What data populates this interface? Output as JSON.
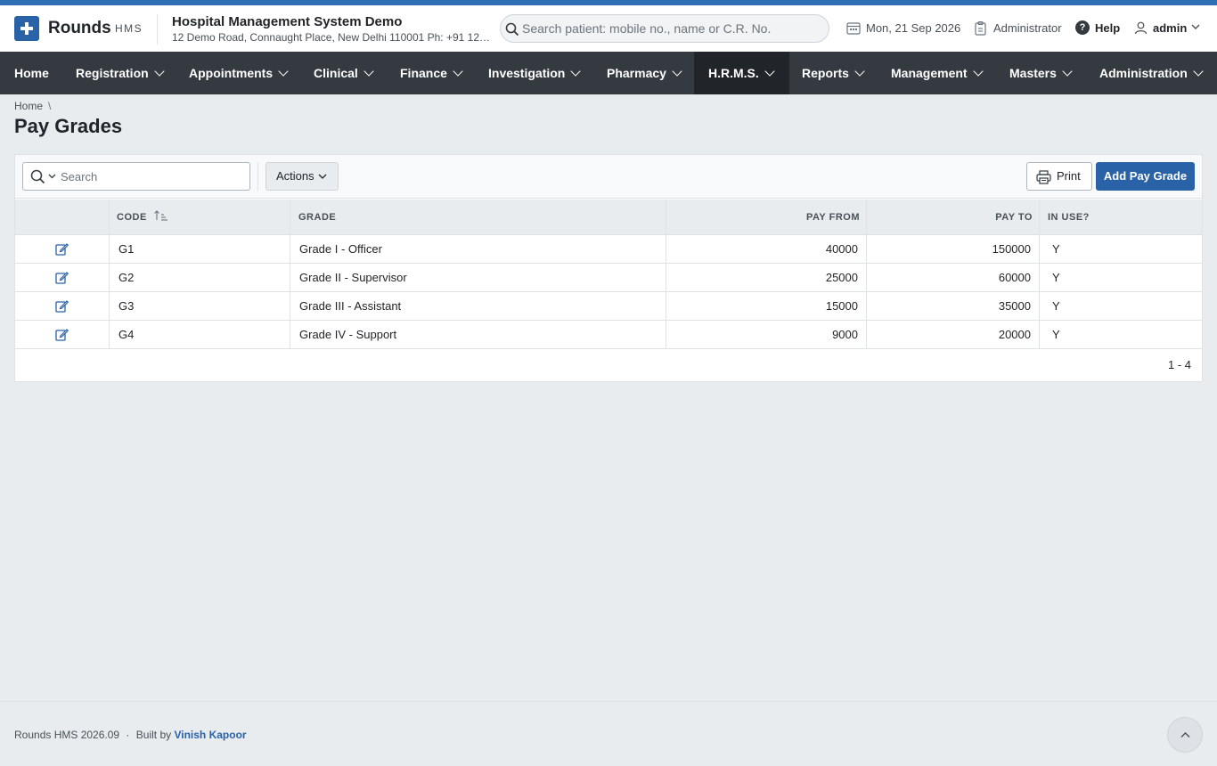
{
  "app": {
    "brand": "Rounds",
    "brand_sub": "HMS",
    "hospital_name": "Hospital Management System Demo",
    "hospital_address": "12 Demo Road, Connaught Place, New Delhi 110001 Ph: +91 123..."
  },
  "patient_search": {
    "placeholder": "Search patient: mobile no., name or C.R. No."
  },
  "header": {
    "date": "Mon, 21 Sep 2026",
    "role": "Administrator",
    "help": "Help",
    "user": "admin"
  },
  "nav": {
    "items": [
      {
        "label": "Home"
      },
      {
        "label": "Registration"
      },
      {
        "label": "Appointments"
      },
      {
        "label": "Clinical"
      },
      {
        "label": "Finance"
      },
      {
        "label": "Investigation"
      },
      {
        "label": "Pharmacy"
      },
      {
        "label": "H.R.M.S."
      },
      {
        "label": "Reports"
      },
      {
        "label": "Management"
      },
      {
        "label": "Masters"
      },
      {
        "label": "Administration"
      }
    ],
    "active": "H.R.M.S."
  },
  "breadcrumb": {
    "home": "Home",
    "separator": "\\"
  },
  "page": {
    "title": "Pay Grades"
  },
  "toolbar": {
    "search_placeholder": "Search",
    "actions_label": "Actions",
    "print_label": "Print",
    "add_label": "Add Pay Grade"
  },
  "table": {
    "columns": {
      "code": "CODE",
      "grade": "GRADE",
      "pay_from": "PAY FROM",
      "pay_to": "PAY TO",
      "in_use": "IN USE?"
    },
    "rows": [
      {
        "code": "G1",
        "grade": "Grade I - Officer",
        "pay_from": "40000",
        "pay_to": "150000",
        "in_use": "Y"
      },
      {
        "code": "G2",
        "grade": "Grade II - Supervisor",
        "pay_from": "25000",
        "pay_to": "60000",
        "in_use": "Y"
      },
      {
        "code": "G3",
        "grade": "Grade III - Assistant",
        "pay_from": "15000",
        "pay_to": "35000",
        "in_use": "Y"
      },
      {
        "code": "G4",
        "grade": "Grade IV - Support",
        "pay_from": "9000",
        "pay_to": "20000",
        "in_use": "Y"
      }
    ],
    "pager": "1 - 4"
  },
  "footer": {
    "version": "Rounds HMS 2026.09",
    "dot": "·",
    "built_by": "Built by",
    "author": "Vinish Kapoor"
  },
  "colors": {
    "primary": "#2a62a8",
    "topstrip": "#2f6eb5",
    "navbar": "#343a40",
    "nav_active": "#212529"
  }
}
